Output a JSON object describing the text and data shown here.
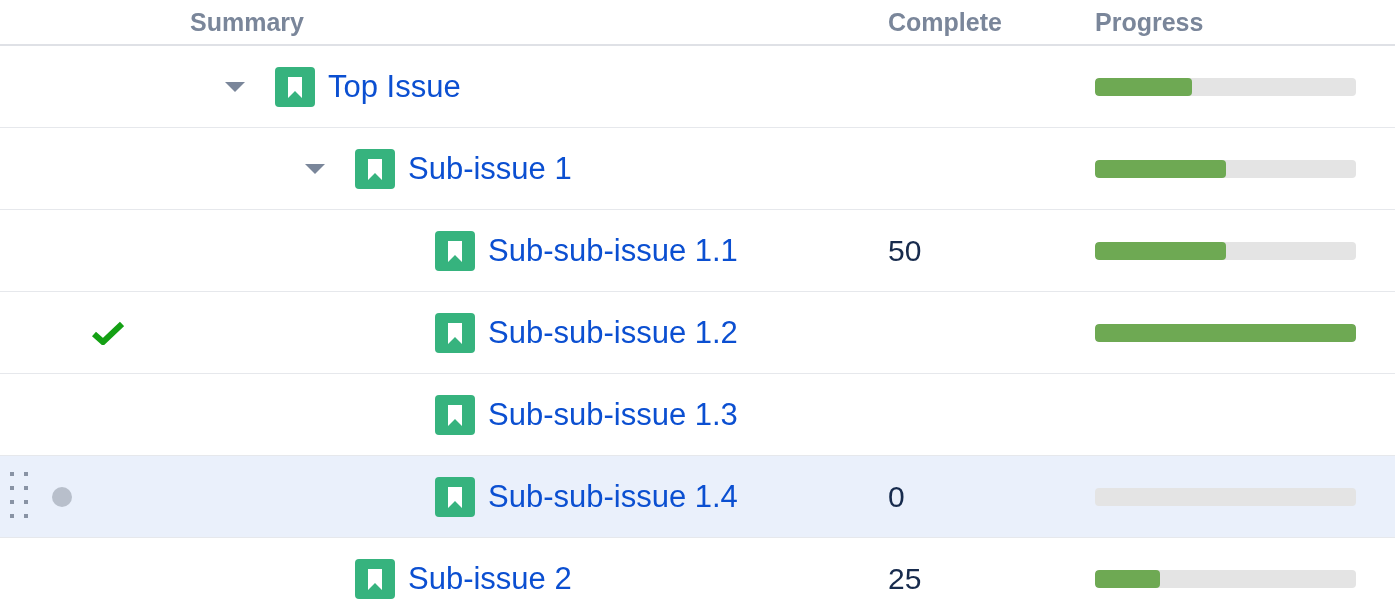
{
  "columns": [
    {
      "label": "Summary"
    },
    {
      "label": "Complete"
    },
    {
      "label": "Progress"
    }
  ],
  "rows": [
    {
      "title": "Top Issue",
      "expanded": true,
      "selected": false,
      "resolved": false,
      "flagged": false,
      "level": 0.37,
      "children": [
        {
          "title": "Sub-issue 1",
          "expanded": true,
          "selected": false,
          "resolved": false,
          "flagged": false,
          "level": 0.5,
          "children": [
            {
              "title": "Sub-sub-issue 1.1",
              "selected": false,
              "resolved": false,
              "flagged": false,
              "complete": "50",
              "level": 0.5
            },
            {
              "title": "Sub-sub-issue 1.2",
              "selected": false,
              "resolved": true,
              "flagged": false,
              "level": 1
            },
            {
              "title": "Sub-sub-issue 1.3",
              "selected": false,
              "resolved": false,
              "flagged": false
            },
            {
              "title": "Sub-sub-issue 1.4",
              "selected": true,
              "resolved": false,
              "flagged": true,
              "complete": "0",
              "level": 0
            }
          ]
        },
        {
          "title": "Sub-issue 2",
          "selected": false,
          "resolved": false,
          "flagged": false,
          "complete": "25",
          "level": 0.25
        }
      ]
    }
  ]
}
